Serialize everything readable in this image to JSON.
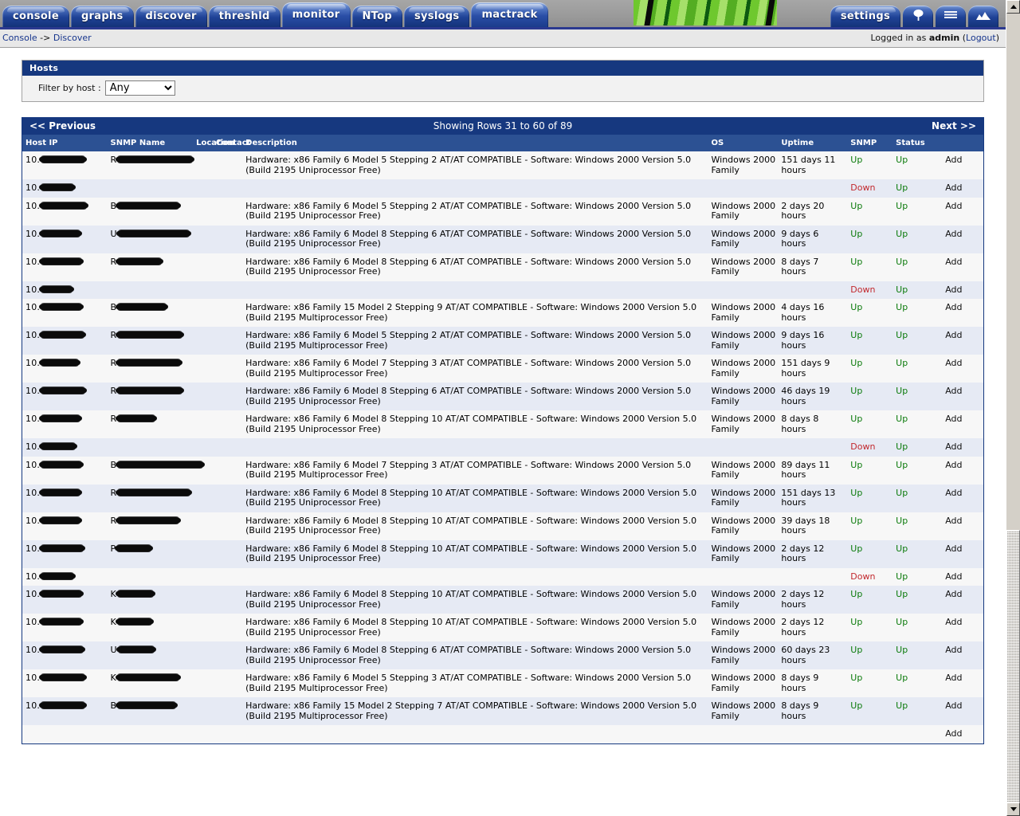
{
  "nav": {
    "tabs": [
      {
        "label": "console",
        "active": false
      },
      {
        "label": "graphs",
        "active": false
      },
      {
        "label": "discover",
        "active": false
      },
      {
        "label": "threshld",
        "active": false
      },
      {
        "label": "monitor",
        "active": true
      },
      {
        "label": "NTop",
        "active": false
      },
      {
        "label": "syslogs",
        "active": false
      },
      {
        "label": "mactrack",
        "active": true
      }
    ],
    "right_tabs": [
      {
        "label": "settings",
        "icon": "settings-text"
      },
      {
        "label": "",
        "icon": "tree-icon"
      },
      {
        "label": "",
        "icon": "list-icon"
      },
      {
        "label": "",
        "icon": "graph-icon"
      }
    ]
  },
  "breadcrumb": {
    "root": "Console",
    "separator": " -> ",
    "current": "Discover",
    "logged_in_prefix": "Logged in as ",
    "user": "admin",
    "logout_open": " (",
    "logout": "Logout",
    "logout_close": ")"
  },
  "hosts_panel": {
    "title": "Hosts",
    "filter_label": "Filter by host :",
    "filter_value": "Any",
    "filter_options": [
      "Any"
    ]
  },
  "pager": {
    "previous": "<< Previous",
    "showing": "Showing Rows 31 to 60 of 89",
    "next": "Next >>"
  },
  "table": {
    "columns": [
      "Host IP",
      "SNMP Name",
      "Location",
      "Contact",
      "Description",
      "OS",
      "Uptime",
      "SNMP",
      "Status",
      ""
    ],
    "ip_prefix": "10.",
    "action_label": "Add",
    "status_up": "Up",
    "status_down": "Down",
    "colors": {
      "up": "#0a7a0a",
      "down": "#c2282d",
      "header_blue": "#16387f",
      "col_header_blue": "#2c5193",
      "row_odd": "#f7f7f7",
      "row_even": "#e6eaf4"
    },
    "rows": [
      {
        "ip_redact": 56,
        "snmp_initial": "R",
        "snmp_redact": 95,
        "description": "Hardware: x86 Family 6 Model 5 Stepping 2 AT/AT COMPATIBLE - Software: Windows 2000 Version 5.0 (Build 2195 Uniprocessor Free)",
        "os": "Windows 2000 Family",
        "uptime": "151 days 11 hours",
        "snmp": "Up",
        "status": "Up"
      },
      {
        "ip_redact": 42,
        "snmp_initial": "",
        "snmp_redact": 0,
        "description": "",
        "os": "",
        "uptime": "",
        "snmp": "Down",
        "status": "Up"
      },
      {
        "ip_redact": 58,
        "snmp_initial": "B",
        "snmp_redact": 78,
        "description": "Hardware: x86 Family 6 Model 5 Stepping 2 AT/AT COMPATIBLE - Software: Windows 2000 Version 5.0 (Build 2195 Uniprocessor Free)",
        "os": "Windows 2000 Family",
        "uptime": "2 days 20 hours",
        "snmp": "Up",
        "status": "Up"
      },
      {
        "ip_redact": 50,
        "snmp_initial": "U",
        "snmp_redact": 90,
        "description": "Hardware: x86 Family 6 Model 8 Stepping 6 AT/AT COMPATIBLE - Software: Windows 2000 Version 5.0 (Build 2195 Uniprocessor Free)",
        "os": "Windows 2000 Family",
        "uptime": "9 days 6 hours",
        "snmp": "Up",
        "status": "Up"
      },
      {
        "ip_redact": 52,
        "snmp_initial": "R",
        "snmp_redact": 56,
        "description": "Hardware: x86 Family 6 Model 8 Stepping 6 AT/AT COMPATIBLE - Software: Windows 2000 Version 5.0 (Build 2195 Uniprocessor Free)",
        "os": "Windows 2000 Family",
        "uptime": "8 days 7 hours",
        "snmp": "Up",
        "status": "Up"
      },
      {
        "ip_redact": 40,
        "snmp_initial": "",
        "snmp_redact": 0,
        "description": "",
        "os": "",
        "uptime": "",
        "snmp": "Down",
        "status": "Up"
      },
      {
        "ip_redact": 52,
        "snmp_initial": "B",
        "snmp_redact": 62,
        "description": "Hardware: x86 Family 15 Model 2 Stepping 9 AT/AT COMPATIBLE - Software: Windows 2000 Version 5.0 (Build 2195 Multiprocessor Free)",
        "os": "Windows 2000 Family",
        "uptime": "4 days 16 hours",
        "snmp": "Up",
        "status": "Up"
      },
      {
        "ip_redact": 55,
        "snmp_initial": "R",
        "snmp_redact": 82,
        "description": "Hardware: x86 Family 6 Model 5 Stepping 2 AT/AT COMPATIBLE - Software: Windows 2000 Version 5.0 (Build 2195 Multiprocessor Free)",
        "os": "Windows 2000 Family",
        "uptime": "9 days 16 hours",
        "snmp": "Up",
        "status": "Up"
      },
      {
        "ip_redact": 48,
        "snmp_initial": "R",
        "snmp_redact": 80,
        "description": "Hardware: x86 Family 6 Model 7 Stepping 3 AT/AT COMPATIBLE - Software: Windows 2000 Version 5.0 (Build 2195 Multiprocessor Free)",
        "os": "Windows 2000 Family",
        "uptime": "151 days 9 hours",
        "snmp": "Up",
        "status": "Up"
      },
      {
        "ip_redact": 56,
        "snmp_initial": "R",
        "snmp_redact": 82,
        "description": "Hardware: x86 Family 6 Model 8 Stepping 6 AT/AT COMPATIBLE - Software: Windows 2000 Version 5.0 (Build 2195 Uniprocessor Free)",
        "os": "Windows 2000 Family",
        "uptime": "46 days 19 hours",
        "snmp": "Up",
        "status": "Up"
      },
      {
        "ip_redact": 50,
        "snmp_initial": "R",
        "snmp_redact": 48,
        "description": "Hardware: x86 Family 6 Model 8 Stepping 10 AT/AT COMPATIBLE - Software: Windows 2000 Version 5.0 (Build 2195 Uniprocessor Free)",
        "os": "Windows 2000 Family",
        "uptime": "8 days 8 hours",
        "snmp": "Up",
        "status": "Up"
      },
      {
        "ip_redact": 44,
        "snmp_initial": "",
        "snmp_redact": 0,
        "description": "",
        "os": "",
        "uptime": "",
        "snmp": "Down",
        "status": "Up"
      },
      {
        "ip_redact": 52,
        "snmp_initial": "B",
        "snmp_redact": 108,
        "description": "Hardware: x86 Family 6 Model 7 Stepping 3 AT/AT COMPATIBLE - Software: Windows 2000 Version 5.0 (Build 2195 Multiprocessor Free)",
        "os": "Windows 2000 Family",
        "uptime": "89 days 11 hours",
        "snmp": "Up",
        "status": "Up"
      },
      {
        "ip_redact": 50,
        "snmp_initial": "R",
        "snmp_redact": 92,
        "description": "Hardware: x86 Family 6 Model 8 Stepping 10 AT/AT COMPATIBLE - Software: Windows 2000 Version 5.0 (Build 2195 Uniprocessor Free)",
        "os": "Windows 2000 Family",
        "uptime": "151 days 13 hours",
        "snmp": "Up",
        "status": "Up"
      },
      {
        "ip_redact": 50,
        "snmp_initial": "R",
        "snmp_redact": 78,
        "description": "Hardware: x86 Family 6 Model 8 Stepping 10 AT/AT COMPATIBLE - Software: Windows 2000 Version 5.0 (Build 2195 Uniprocessor Free)",
        "os": "Windows 2000 Family",
        "uptime": "39 days 18 hours",
        "snmp": "Up",
        "status": "Up"
      },
      {
        "ip_redact": 54,
        "snmp_initial": "P",
        "snmp_redact": 44,
        "description": "Hardware: x86 Family 6 Model 8 Stepping 10 AT/AT COMPATIBLE - Software: Windows 2000 Version 5.0 (Build 2195 Uniprocessor Free)",
        "os": "Windows 2000 Family",
        "uptime": "2 days 12 hours",
        "snmp": "Up",
        "status": "Up"
      },
      {
        "ip_redact": 42,
        "snmp_initial": "",
        "snmp_redact": 0,
        "description": "",
        "os": "",
        "uptime": "",
        "snmp": "Down",
        "status": "Up"
      },
      {
        "ip_redact": 52,
        "snmp_initial": "K",
        "snmp_redact": 46,
        "description": "Hardware: x86 Family 6 Model 8 Stepping 10 AT/AT COMPATIBLE - Software: Windows 2000 Version 5.0 (Build 2195 Uniprocessor Free)",
        "os": "Windows 2000 Family",
        "uptime": "2 days 12 hours",
        "snmp": "Up",
        "status": "Up"
      },
      {
        "ip_redact": 52,
        "snmp_initial": "K",
        "snmp_redact": 44,
        "description": "Hardware: x86 Family 6 Model 8 Stepping 10 AT/AT COMPATIBLE - Software: Windows 2000 Version 5.0 (Build 2195 Uniprocessor Free)",
        "os": "Windows 2000 Family",
        "uptime": "2 days 12 hours",
        "snmp": "Up",
        "status": "Up"
      },
      {
        "ip_redact": 54,
        "snmp_initial": "U",
        "snmp_redact": 46,
        "description": "Hardware: x86 Family 6 Model 8 Stepping 6 AT/AT COMPATIBLE - Software: Windows 2000 Version 5.0 (Build 2195 Uniprocessor Free)",
        "os": "Windows 2000 Family",
        "uptime": "60 days 23 hours",
        "snmp": "Up",
        "status": "Up"
      },
      {
        "ip_redact": 56,
        "snmp_initial": "K",
        "snmp_redact": 78,
        "description": "Hardware: x86 Family 6 Model 5 Stepping 3 AT/AT COMPATIBLE - Software: Windows 2000 Version 5.0 (Build 2195 Multiprocessor Free)",
        "os": "Windows 2000 Family",
        "uptime": "8 days 9 hours",
        "snmp": "Up",
        "status": "Up"
      },
      {
        "ip_redact": 56,
        "snmp_initial": "B",
        "snmp_redact": 74,
        "description": "Hardware: x86 Family 15 Model 2 Stepping 7 AT/AT COMPATIBLE - Software: Windows 2000 Version 5.0 (Build 2195 Multiprocessor Free)",
        "os": "Windows 2000 Family",
        "uptime": "8 days 9 hours",
        "snmp": "Up",
        "status": "Up"
      },
      {
        "ip_redact": 0,
        "snmp_initial": "",
        "snmp_redact": 0,
        "description": "",
        "os": "",
        "uptime": "",
        "snmp": "",
        "status": ""
      }
    ]
  },
  "scrollbar": {
    "up_arrow": "scroll-up-arrow",
    "down_arrow": "scroll-down-arrow"
  }
}
